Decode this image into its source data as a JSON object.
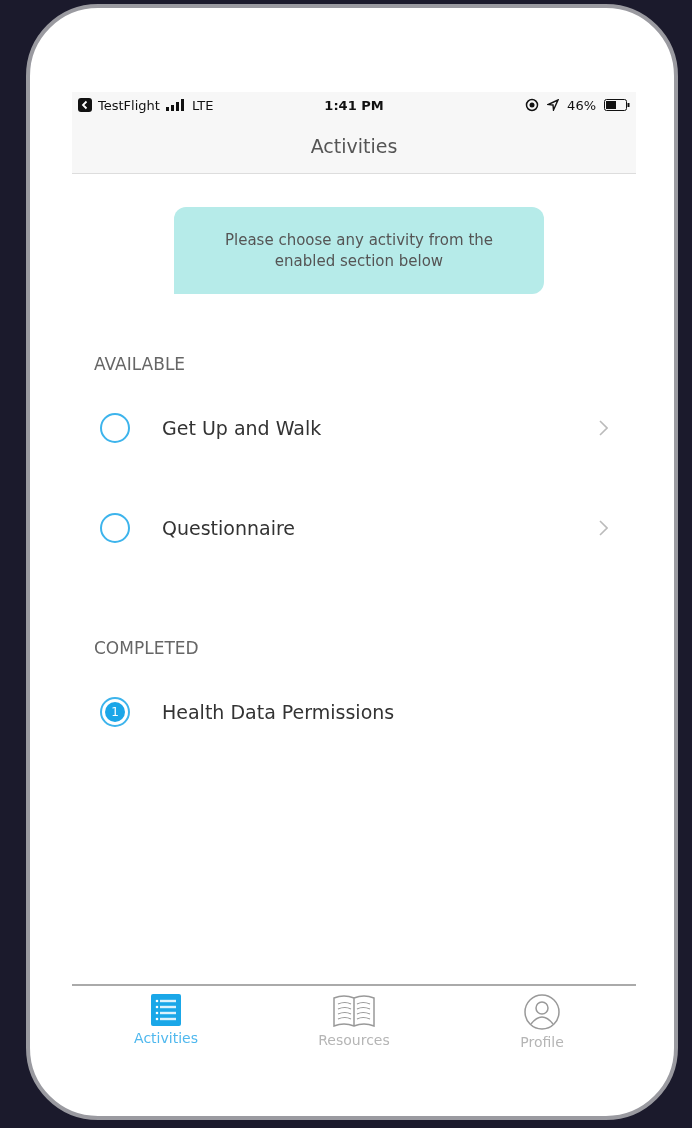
{
  "status_bar": {
    "back_app": "TestFlight",
    "network": "LTE",
    "time": "1:41 PM",
    "battery": "46%"
  },
  "nav": {
    "title": "Activities"
  },
  "banner": {
    "text": "Please choose any activity from the enabled section below"
  },
  "sections": [
    {
      "title": "AVAILABLE",
      "items": [
        {
          "label": "Get Up and Walk",
          "kind": "available"
        },
        {
          "label": "Questionnaire",
          "kind": "available"
        }
      ]
    },
    {
      "title": "COMPLETED",
      "items": [
        {
          "label": "Health Data Permissions",
          "kind": "completed",
          "count": "1"
        }
      ]
    }
  ],
  "tabs": [
    {
      "label": "Activities",
      "kind": "list",
      "selected": true
    },
    {
      "label": "Resources",
      "kind": "book",
      "selected": false
    },
    {
      "label": "Profile",
      "kind": "person",
      "selected": false
    }
  ]
}
